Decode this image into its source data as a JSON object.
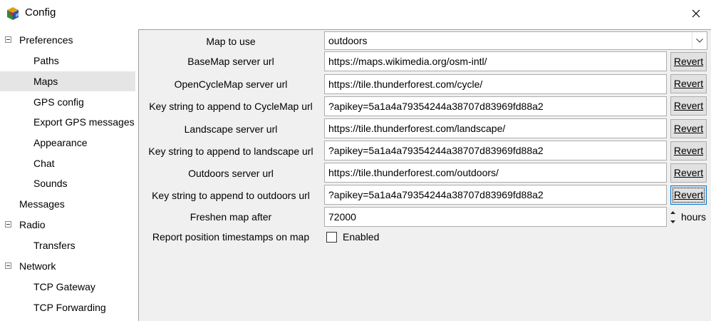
{
  "window": {
    "title": "Config"
  },
  "tree": [
    {
      "label": "Preferences",
      "expander": true
    },
    {
      "label": "Paths"
    },
    {
      "label": "Maps",
      "selected": true
    },
    {
      "label": "GPS config"
    },
    {
      "label": "Export GPS messages"
    },
    {
      "label": "Appearance"
    },
    {
      "label": "Chat"
    },
    {
      "label": "Sounds"
    },
    {
      "label": "Messages"
    },
    {
      "label": "Radio",
      "expander": true
    },
    {
      "label": "Transfers"
    },
    {
      "label": "Network",
      "expander": true
    },
    {
      "label": "TCP Gateway"
    },
    {
      "label": "TCP Forwarding"
    }
  ],
  "form": {
    "map_to_use": {
      "label": "Map to use",
      "value": "outdoors"
    },
    "rows": [
      {
        "label": "BaseMap server url",
        "value": "https://maps.wikimedia.org/osm-intl/",
        "revert": "Revert"
      },
      {
        "label": "OpenCycleMap server url",
        "value": "https://tile.thunderforest.com/cycle/",
        "revert": "Revert"
      },
      {
        "label": "Key string to append to CycleMap url",
        "value": "?apikey=5a1a4a79354244a38707d83969fd88a2",
        "revert": "Revert"
      },
      {
        "label": "Landscape server url",
        "value": "https://tile.thunderforest.com/landscape/",
        "revert": "Revert"
      },
      {
        "label": "Key string to append to landscape url",
        "value": "?apikey=5a1a4a79354244a38707d83969fd88a2",
        "revert": "Revert"
      },
      {
        "label": "Outdoors server url",
        "value": "https://tile.thunderforest.com/outdoors/",
        "revert": "Revert"
      },
      {
        "label": "Key string to append to outdoors url",
        "value": "?apikey=5a1a4a79354244a38707d83969fd88a2",
        "revert": "Revert"
      }
    ],
    "freshen": {
      "label": "Freshen map after",
      "value": "72000",
      "suffix": "hours"
    },
    "timestamps": {
      "label": "Report position timestamps on map",
      "checkbox_label": "Enabled",
      "checked": false
    }
  }
}
